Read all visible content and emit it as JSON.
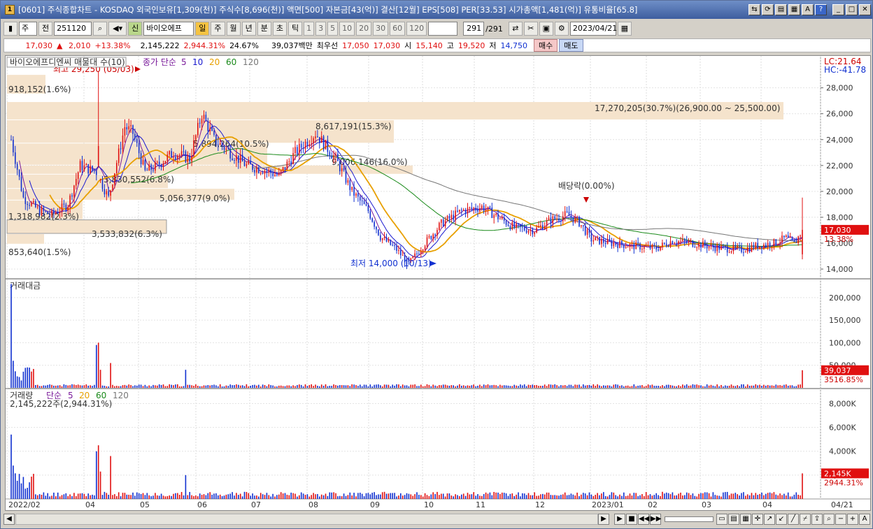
{
  "window": {
    "title": "[0601] 주식종합차트 - KOSDAQ 외국인보유[1,309(천)] 주식수[8,696(천)] 액면[500] 자본금[43(억)] 결산[12월] EPS[508] PER[33.53] 시가총액[1,481(억)] 유통비율[65.8]"
  },
  "toolbar": {
    "period": "주",
    "jeon": "전",
    "code": "251120",
    "stock_name": "바이오에프",
    "sin": "신",
    "timeframes": [
      "일",
      "주",
      "월",
      "년",
      "분",
      "초",
      "틱"
    ],
    "tick_nums": [
      "1",
      "3",
      "5",
      "10",
      "20",
      "30",
      "60",
      "120"
    ],
    "count_value": "291",
    "count_total": "/291",
    "date": "2023/04/21"
  },
  "quote": {
    "price": "17,030",
    "change": "2,010",
    "change_pct": "+13.38%",
    "volume": "2,145,222",
    "vol_ratio": "2,944.31%",
    "turnover": "24.67%",
    "trade_value": "39,037백만",
    "priority_label": "최우선",
    "bid": "17,050",
    "ask": "17,030",
    "open_label": "시",
    "open": "15,140",
    "high_label": "고",
    "high": "19,520",
    "low_label": "저",
    "low": "14,750",
    "buy": "매수",
    "sell": "매도"
  },
  "price_panel": {
    "title": "바이오에프디엔씨 매물대 수(10)",
    "ma_label": "종가 단순",
    "ma_periods": [
      "5",
      "10",
      "20",
      "60",
      "120"
    ],
    "max_label": "최고 29,250 (05/03)",
    "min_label": "최저 14,000 (10/13)",
    "dividend_label": "배당락(0.00%)",
    "lc": "LC:21.64",
    "hc": "HC:-41.78",
    "current": "17,030",
    "current_pct": "13.38%",
    "yticks": [
      "28,000",
      "26,000",
      "24,000",
      "22,000",
      "20,000",
      "18,000",
      "16,000",
      "14,000"
    ],
    "volume_profile": [
      {
        "label": "918,152(1.6%)"
      },
      {
        "label": "17,270,205(30.7%)(26,900.00 ~ 25,500.00)"
      },
      {
        "label": "8,617,191(15.3%)"
      },
      {
        "label": "5,894,264(10.5%)"
      },
      {
        "label": "9,006,146(16.0%)"
      },
      {
        "label": "3,830,552(6.8%)"
      },
      {
        "label": "5,056,377(9.0%)"
      },
      {
        "label": "1,318,982(2.3%)"
      },
      {
        "label": "3,533,832(6.3%)"
      },
      {
        "label": "853,640(1.5%)"
      }
    ]
  },
  "value_panel": {
    "title": "거래대금",
    "yticks": [
      "200,000",
      "150,000",
      "100,000",
      "50,000"
    ],
    "current": "39,037",
    "current_pct": "3516.85%"
  },
  "volume_panel": {
    "title": "거래량",
    "ma_label": "단순",
    "ma_periods": [
      "5",
      "20",
      "60",
      "120"
    ],
    "subtitle": "2,145,222주(2,944.31%)",
    "yticks": [
      "8,000K",
      "6,000K",
      "4,000K",
      "2,000K"
    ],
    "current": "2,145K",
    "current_pct": "2944.31%"
  },
  "xaxis": {
    "labels": [
      "2022/02",
      "04",
      "05",
      "06",
      "07",
      "08",
      "09",
      "10",
      "11",
      "12",
      "2023/01",
      "02",
      "03",
      "04"
    ],
    "right_label": "04/21"
  },
  "colors": {
    "up": "#e01010",
    "down": "#1030d0",
    "ma5": "#7a1a9a",
    "ma10": "#1a1ad0",
    "ma20": "#e8a000",
    "ma60": "#1a8a1a",
    "ma120": "#777777",
    "profile": "#f5e3cc"
  },
  "chart_data": {
    "type": "candlestick",
    "ylim": [
      13300,
      29600
    ],
    "highlights": {
      "max": 29250,
      "min": 14000,
      "close": 17030,
      "last_high": 19520,
      "last_low": 14750,
      "last_open": 15140
    }
  }
}
